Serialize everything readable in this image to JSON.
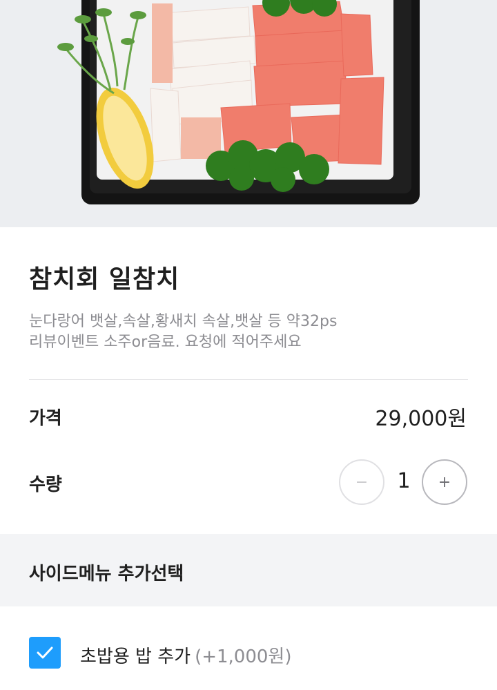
{
  "product": {
    "title": "참치회 일참치",
    "description_line1": "눈다랑어 뱃살,속살,황새치 속살,뱃살 등 약32ps",
    "description_line2": "리뷰이벤트 소주or음료. 요청에 적어주세요"
  },
  "price": {
    "label": "가격",
    "value": "29,000원"
  },
  "quantity": {
    "label": "수량",
    "value": "1",
    "minus_symbol": "−",
    "plus_symbol": "+"
  },
  "side_menu": {
    "title": "사이드메뉴 추가선택",
    "options": [
      {
        "label": "초밥용 밥 추가",
        "price": "(+1,000원)",
        "checked": true
      }
    ]
  },
  "colors": {
    "accent": "#1e9dfc",
    "section_bg": "#f3f4f6",
    "muted_text": "#8d8d92"
  },
  "icons": {
    "checkbox": "check-icon"
  }
}
